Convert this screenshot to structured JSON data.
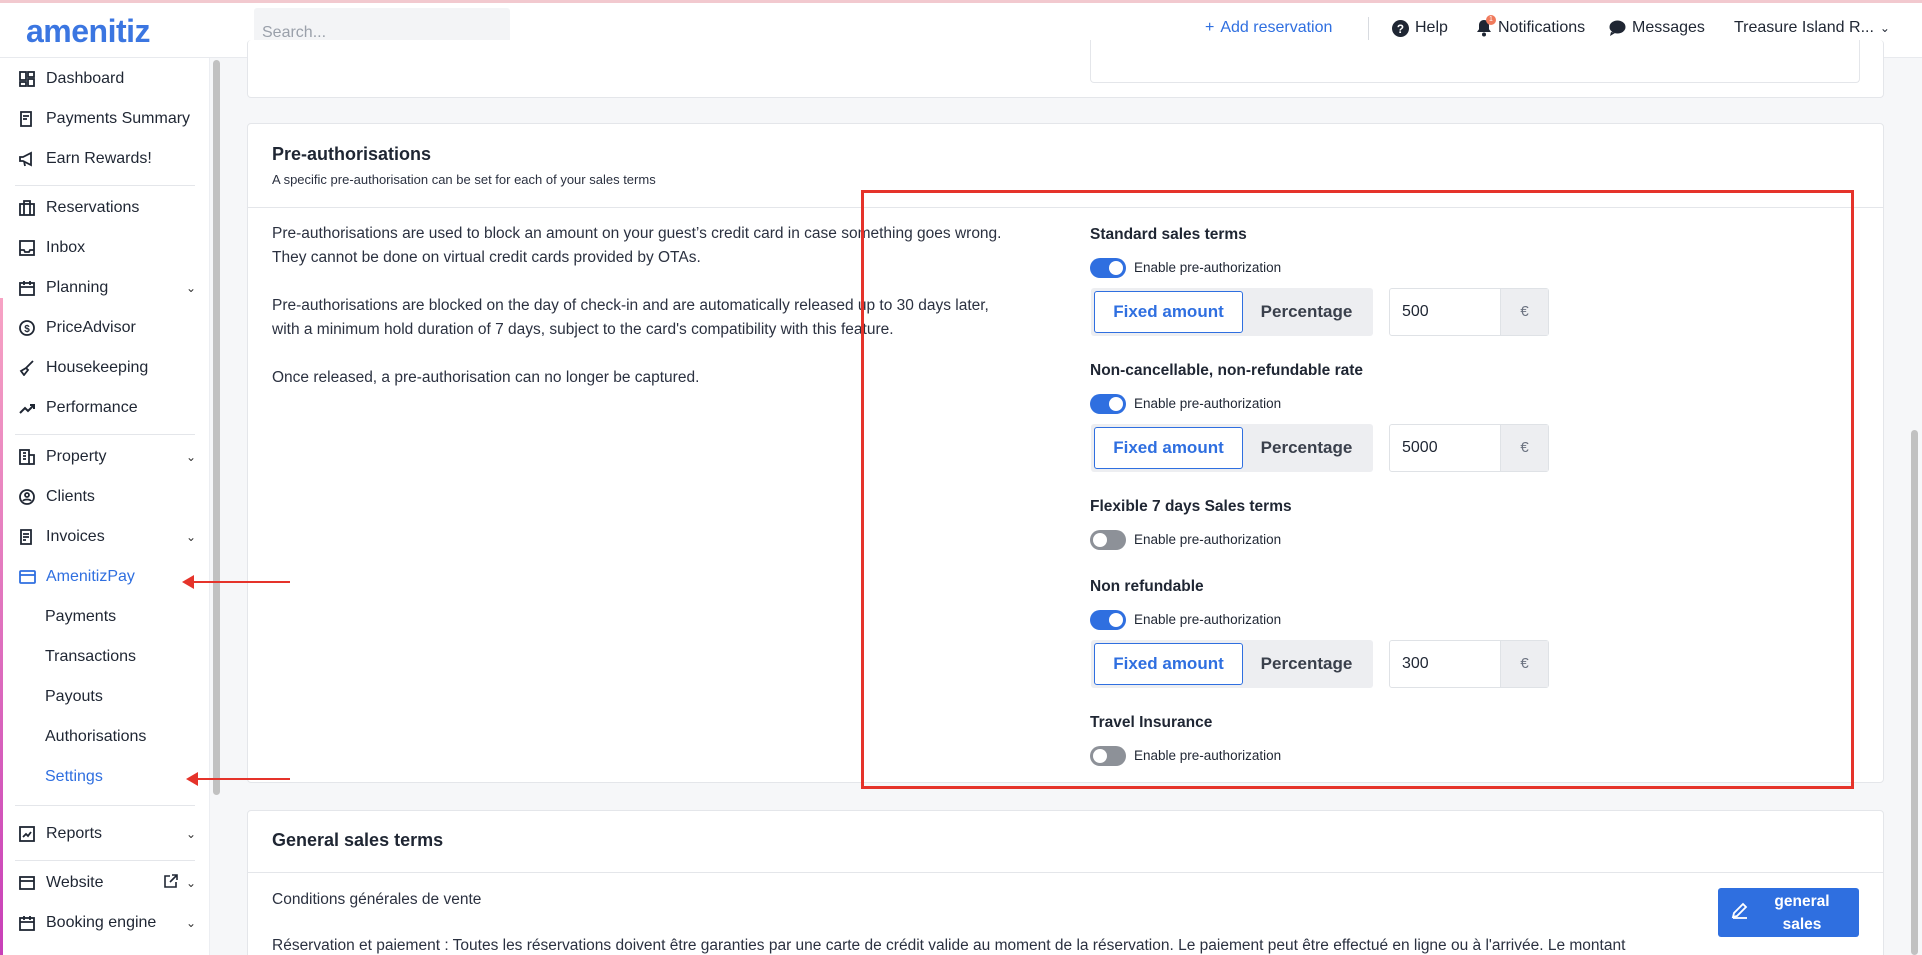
{
  "header": {
    "logo": "amenitiz",
    "search_placeholder": "Search...",
    "add_reservation": "Add reservation",
    "help": "Help",
    "notifications": "Notifications",
    "notification_count": "1",
    "messages": "Messages",
    "property_name": "Treasure Island R..."
  },
  "sidebar": {
    "items": [
      {
        "label": "Dashboard",
        "icon": "dashboard-icon"
      },
      {
        "label": "Payments Summary",
        "icon": "payments-summary-icon"
      },
      {
        "label": "Earn Rewards!",
        "icon": "megaphone-icon"
      },
      {
        "label": "Reservations",
        "icon": "suitcase-icon"
      },
      {
        "label": "Inbox",
        "icon": "inbox-icon"
      },
      {
        "label": "Planning",
        "icon": "calendar-icon"
      },
      {
        "label": "PriceAdvisor",
        "icon": "dollar-icon"
      },
      {
        "label": "Housekeeping",
        "icon": "broom-icon"
      },
      {
        "label": "Performance",
        "icon": "trend-icon"
      },
      {
        "label": "Property",
        "icon": "building-icon"
      },
      {
        "label": "Clients",
        "icon": "clients-icon"
      },
      {
        "label": "Invoices",
        "icon": "invoice-icon"
      },
      {
        "label": "AmenitizPay",
        "icon": "card-icon"
      },
      {
        "label": "Reports",
        "icon": "report-icon"
      },
      {
        "label": "Website",
        "icon": "website-icon"
      },
      {
        "label": "Booking engine",
        "icon": "booking-icon"
      }
    ],
    "amenitizpay_sub": [
      "Payments",
      "Transactions",
      "Payouts",
      "Authorisations",
      "Settings"
    ]
  },
  "preauth": {
    "title": "Pre-authorisations",
    "subtitle": "A specific pre-authorisation can be set for each of your sales terms",
    "para1_line1": "Pre-authorisations are used to block an amount on your guest’s credit card in case something goes wrong.",
    "para1_line2": "They cannot be done on virtual credit cards provided by OTAs.",
    "para2_line1": "Pre-authorisations are blocked on the day of check-in and are automatically released up to 30 days later,",
    "para2_line2": "with a minimum hold duration of 7 days, subject to the card's compatibility with this feature.",
    "para3": "Once released, a pre-authorisation can no longer be captured.",
    "enable_label": "Enable pre-authorization",
    "fixed_label": "Fixed amount",
    "percentage_label": "Percentage",
    "currency": "€",
    "terms": [
      {
        "name": "Standard sales terms",
        "enabled": true,
        "amount": "500"
      },
      {
        "name": "Non-cancellable, non-refundable rate",
        "enabled": true,
        "amount": "5000"
      },
      {
        "name": "Flexible 7 days Sales terms",
        "enabled": false
      },
      {
        "name": "Non refundable",
        "enabled": true,
        "amount": "300"
      },
      {
        "name": "Travel Insurance",
        "enabled": false
      }
    ]
  },
  "general": {
    "title": "General sales terms",
    "line1": "Conditions générales de vente",
    "line2": "Réservation et paiement : Toutes les réservations doivent être garanties par une carte de crédit valide au moment de la réservation. Le paiement peut être effectué en ligne ou à l'arrivée. Le montant",
    "edit_button": "general sales"
  },
  "colors": {
    "accent": "#2f6fe0",
    "annotation": "#e5332a"
  }
}
